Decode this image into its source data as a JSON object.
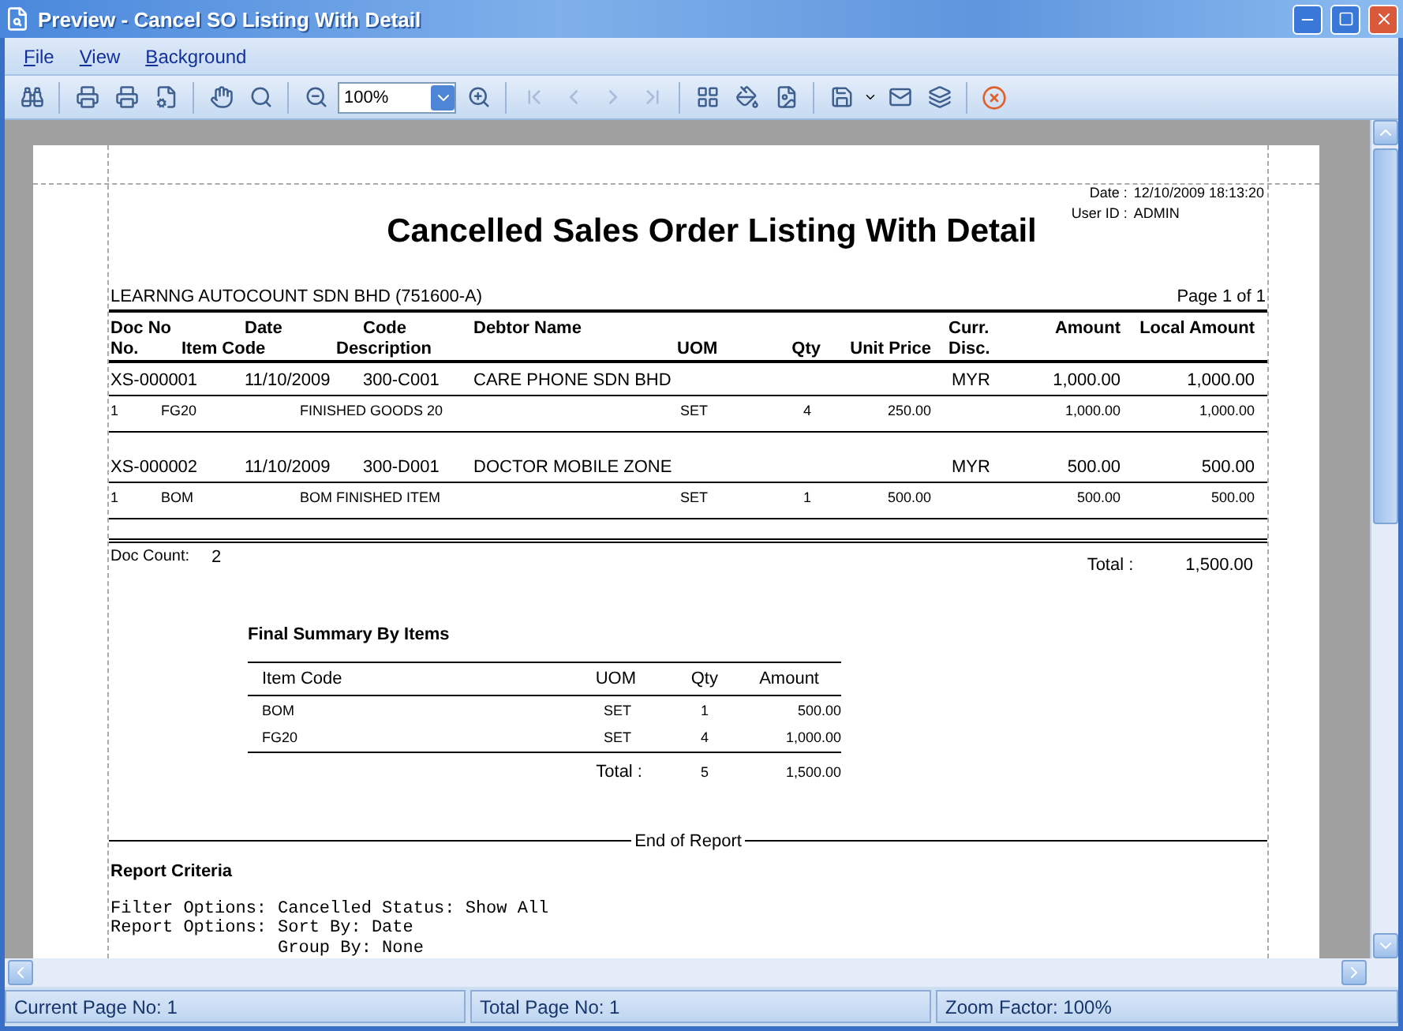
{
  "window": {
    "title": "Preview - Cancel SO Listing With Detail"
  },
  "menu": [
    "File",
    "View",
    "Background"
  ],
  "toolbar": {
    "zoom": "100%",
    "page_navigation": {
      "disabled": true
    }
  },
  "report": {
    "date_label": "Date :",
    "date": "12/10/2009 18:13:20",
    "user_label": "User ID :",
    "user": "ADMIN",
    "title": "Cancelled Sales Order Listing With Detail",
    "company": "LEARNNG AUTOCOUNT SDN BHD (751600-A)",
    "page": "Page 1 of 1",
    "header_1": [
      "Doc No",
      "Date",
      "Code",
      "Debtor Name",
      "Curr.",
      "Amount",
      "Local Amount"
    ],
    "header_2": [
      "No.",
      "Item Code",
      "Description",
      "UOM",
      "Qty",
      "Unit Price",
      "Disc."
    ],
    "documents": [
      {
        "doc_no": "XS-000001",
        "date": "11/10/2009",
        "code": "300-C001",
        "debtor": "CARE PHONE SDN BHD",
        "currency": "MYR",
        "amount": "1,000.00",
        "local_amount": "1,000.00",
        "details": [
          {
            "no": "1",
            "item_code": "FG20",
            "description": "FINISHED GOODS 20",
            "uom": "SET",
            "qty": "4",
            "unit_price": "250.00",
            "amount": "1,000.00",
            "local_amount": "1,000.00"
          }
        ]
      },
      {
        "doc_no": "XS-000002",
        "date": "11/10/2009",
        "code": "300-D001",
        "debtor": "DOCTOR MOBILE ZONE",
        "currency": "MYR",
        "amount": "500.00",
        "local_amount": "500.00",
        "details": [
          {
            "no": "1",
            "item_code": "BOM",
            "description": "BOM FINISHED ITEM",
            "uom": "SET",
            "qty": "1",
            "unit_price": "500.00",
            "amount": "500.00",
            "local_amount": "500.00"
          }
        ]
      }
    ],
    "doc_count_label": "Doc Count:",
    "doc_count": "2",
    "total_label": "Total :",
    "total": "1,500.00",
    "summary": {
      "title": "Final Summary By Items",
      "columns": [
        "Item Code",
        "UOM",
        "Qty",
        "Amount"
      ],
      "rows": [
        {
          "item_code": "BOM",
          "uom": "SET",
          "qty": "1",
          "amount": "500.00"
        },
        {
          "item_code": "FG20",
          "uom": "SET",
          "qty": "4",
          "amount": "1,000.00"
        }
      ],
      "total_label": "Total :",
      "total_qty": "5",
      "total_amount": "1,500.00"
    },
    "end_label": "End of Report",
    "criteria": {
      "title": "Report Criteria",
      "lines": [
        {
          "label": "Filter Options:",
          "values": [
            "Cancelled Status: Show All"
          ]
        },
        {
          "label": "Report Options:",
          "values": [
            "Sort By: Date",
            "Group By: None"
          ]
        }
      ]
    }
  },
  "status_bar": [
    "Current Page No: 1",
    "Total Page No: 1",
    "Zoom Factor: 100%"
  ]
}
